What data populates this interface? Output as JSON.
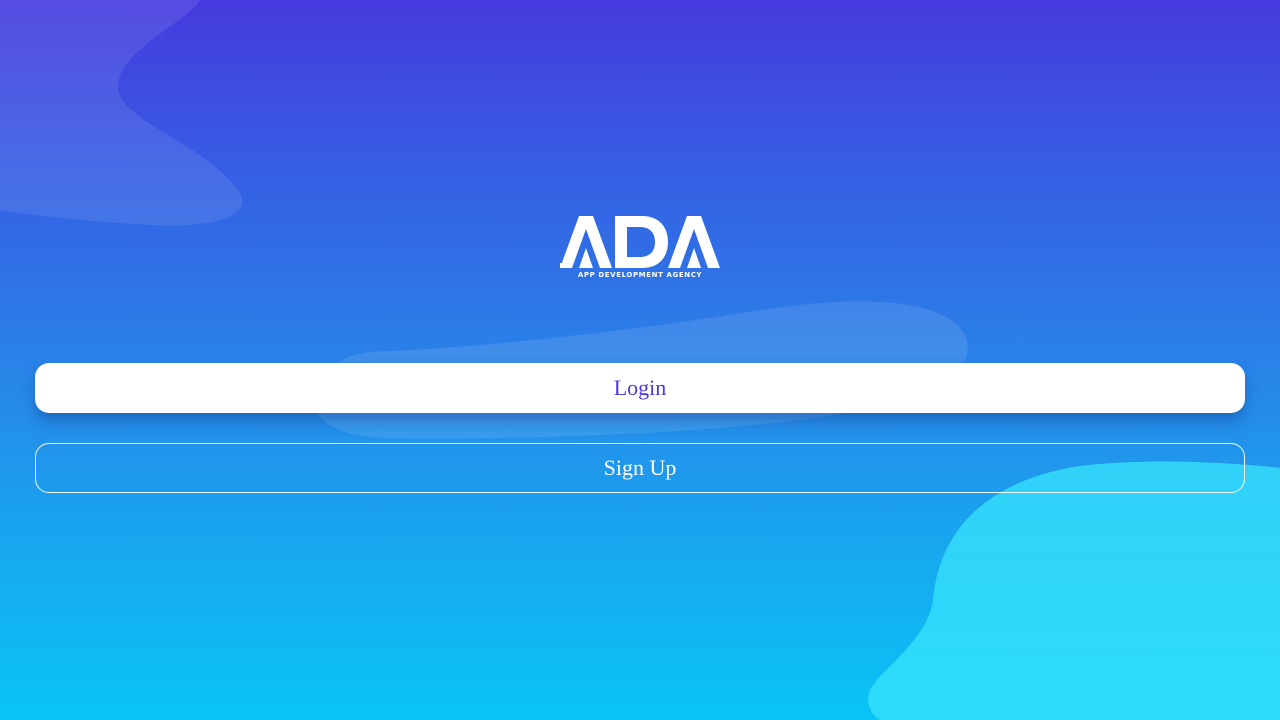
{
  "logo": {
    "wordmark": "ADA",
    "tagline": "APP DEVELOPMENT AGENCY"
  },
  "actions": {
    "login_label": "Login",
    "signup_label": "Sign Up"
  },
  "colors": {
    "background_top": "#463ade",
    "background_bottom": "#0ac4f6",
    "login_text": "#4a39d8",
    "button_white": "#ffffff"
  }
}
